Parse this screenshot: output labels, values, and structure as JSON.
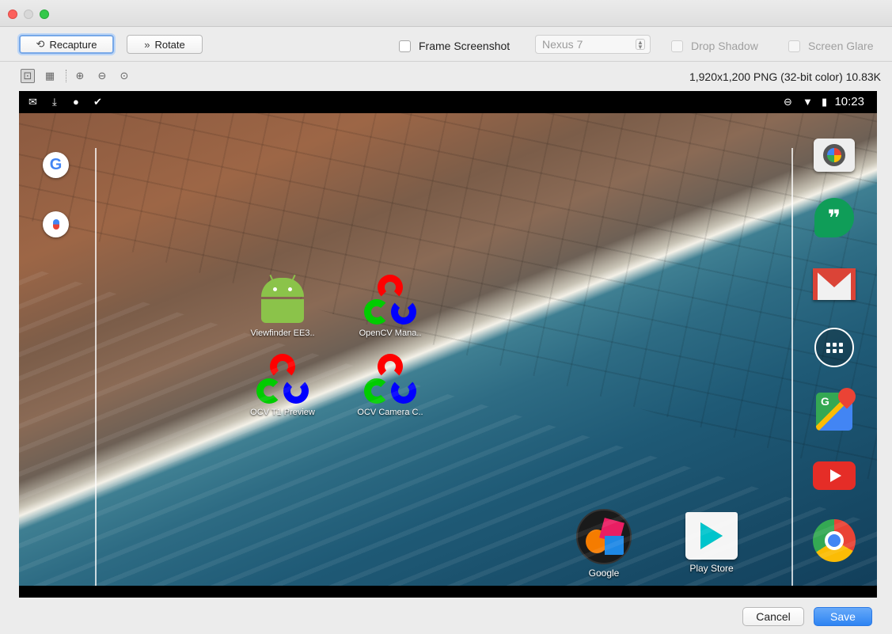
{
  "window": {
    "traffic_lights": [
      "close",
      "minimize",
      "maximize"
    ]
  },
  "toolbar": {
    "recapture_label": "Recapture",
    "rotate_label": "Rotate",
    "frame_screenshot_label": "Frame Screenshot",
    "frame_screenshot_checked": false,
    "device_select_value": "Nexus 7",
    "drop_shadow_label": "Drop Shadow",
    "drop_shadow_enabled": false,
    "screen_glare_label": "Screen Glare",
    "screen_glare_enabled": false
  },
  "viewbar": {
    "tools": [
      "fit-icon",
      "actual-size-icon",
      "zoom-in-icon",
      "zoom-out-icon",
      "zoom-actual-icon"
    ],
    "image_info": "1,920x1,200 PNG (32-bit color) 10.83K"
  },
  "device": {
    "status_left_icons": [
      "gmail-notification-icon",
      "download-icon",
      "android-notification-icon",
      "clipboard-icon"
    ],
    "status_right_icons": [
      "do-not-disturb-icon",
      "wifi-icon",
      "battery-icon"
    ],
    "time": "10:23",
    "desktop_apps": [
      {
        "label": "Viewfinder EE3..",
        "icon": "android-app-icon"
      },
      {
        "label": "OpenCV Mana..",
        "icon": "opencv-icon"
      },
      {
        "label": "OCV T1 Preview",
        "icon": "opencv-icon"
      },
      {
        "label": "OCV Camera C..",
        "icon": "opencv-icon"
      }
    ],
    "left_widgets": [
      "google-search-icon",
      "voice-search-icon"
    ],
    "dock_icons": [
      "camera-app-icon",
      "hangouts-icon",
      "gmail-icon",
      "app-drawer-icon",
      "maps-icon",
      "youtube-icon",
      "chrome-icon"
    ],
    "bottom_apps": [
      {
        "label": "Google",
        "icon": "google-folder-icon"
      },
      {
        "label": "Play Store",
        "icon": "play-store-icon"
      }
    ]
  },
  "footer": {
    "cancel_label": "Cancel",
    "save_label": "Save"
  },
  "colors": {
    "accent": "#2e84f2",
    "focus_ring": "#77a8e8"
  }
}
